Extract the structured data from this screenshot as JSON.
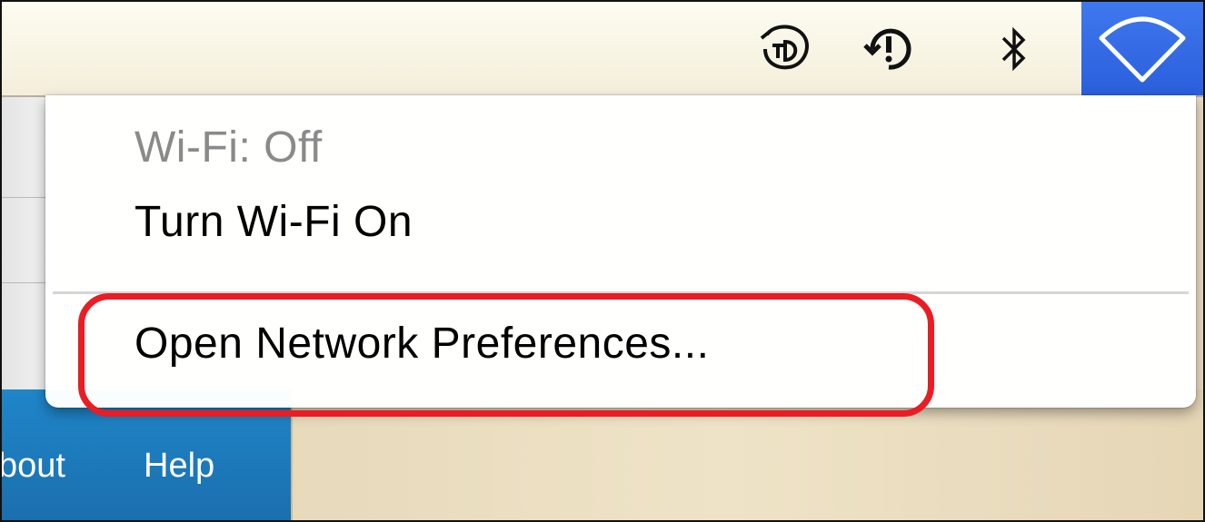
{
  "menubar": {
    "icons": [
      "textexpander-icon",
      "time-machine-icon",
      "bluetooth-icon",
      "wifi-icon"
    ]
  },
  "wifi_menu": {
    "status": "Wi-Fi: Off",
    "toggle_label": "Turn Wi-Fi On",
    "preferences_label": "Open Network Preferences..."
  },
  "background_nav": {
    "items": [
      "bout",
      "Help"
    ]
  },
  "colors": {
    "highlight": "#ea1c24",
    "wifi_active": "#2a5fdc",
    "nav_bar": "#1b6fae"
  }
}
